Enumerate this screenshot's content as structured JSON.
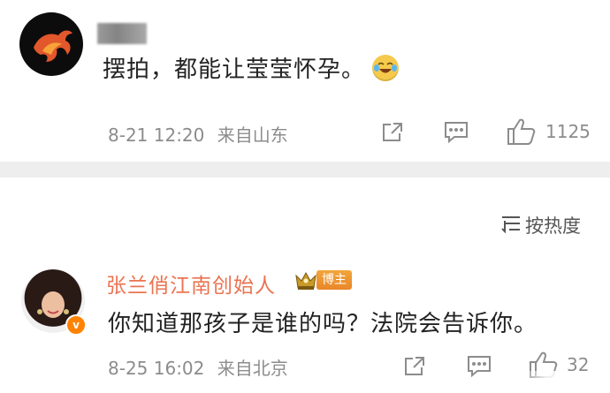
{
  "comment1": {
    "text": "摆拍，都能让莹莹怀孕。",
    "emoji_icon": "laugh-cry-emoji",
    "time": "8-21 12:20",
    "location": "来自山东",
    "like_count": "1125"
  },
  "sort": {
    "label": "按热度"
  },
  "comment2": {
    "username": "张兰俏江南创始人",
    "badge_label": "博主",
    "verified_mark": "v",
    "text": "你知道那孩子是谁的吗？法院会告诉你。",
    "time": "8-25 16:02",
    "location": "来自北京",
    "like_count": "32"
  },
  "colors": {
    "username": "#eb7350",
    "meta": "#8c8c8c",
    "badge": "#ff8200",
    "divider": "#eeeeee"
  }
}
